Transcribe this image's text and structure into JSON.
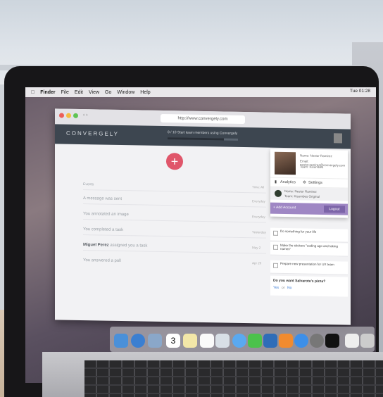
{
  "menubar": {
    "apple": "",
    "items": [
      "Finder",
      "File",
      "Edit",
      "View",
      "Go",
      "Window",
      "Help"
    ],
    "clock": "Tue 01:28"
  },
  "browser": {
    "url": "http://www.convergely.com"
  },
  "app": {
    "logo": "CONVERGELY",
    "progress_text": "8 / 10  Start team members using Convergely",
    "progress_fraction": 0.8,
    "add_icon": "plus-icon",
    "feed": [
      {
        "text": "Events",
        "time": "Time: All"
      },
      {
        "text": "A message was sent",
        "time": "Everyday"
      },
      {
        "text": "You annotated an image",
        "time": "Everyday"
      },
      {
        "text": "You completed a task",
        "time": "Yesterday"
      },
      {
        "actor": "Miguel Perez",
        "text": "assigned you a task",
        "time": "May 2"
      },
      {
        "text": "You answered a poll",
        "time": "Apr 20"
      }
    ]
  },
  "profile": {
    "name": "Name: Nestor Ramirez",
    "email": "Email: nestor.ramirez@convergely.com",
    "team": "Team: Kisumbes",
    "analytics": "Analytics",
    "settings": "Settings",
    "team_name": "Name: Nestor Ramirez",
    "team_sub": "Team: Kisumbes Original",
    "add_account": "+ Add Account",
    "logout": "Logout"
  },
  "tasks": [
    {
      "text": "Do something for your life"
    },
    {
      "text": "Make the stickers \"coding ago and taking names\""
    },
    {
      "text": "Prepare new presentation for UX team"
    }
  ],
  "poll": {
    "question": "Do you want Salvarote's pizza?",
    "yes": "Yes",
    "or": "or",
    "no": "No"
  },
  "colors": {
    "appbar": "#3d4650",
    "accent": "#e0566a",
    "purple": "#9f87c4"
  }
}
